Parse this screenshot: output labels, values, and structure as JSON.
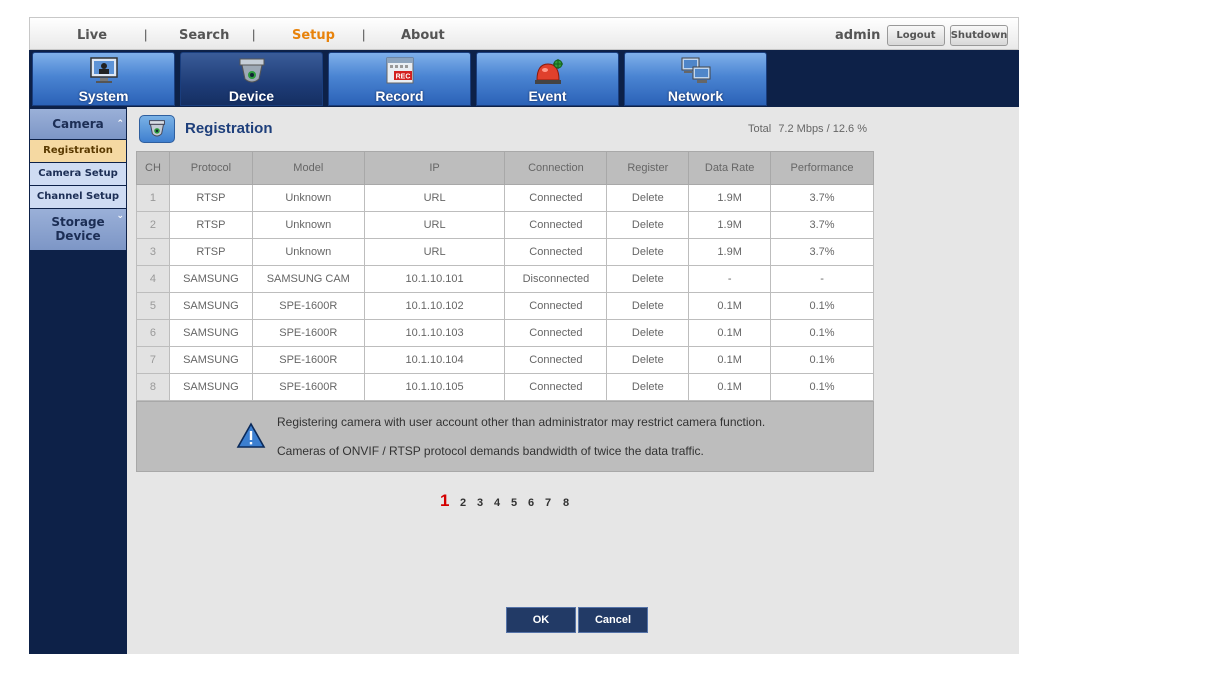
{
  "topnav": {
    "links": [
      "Live",
      "Search",
      "Setup",
      "About"
    ],
    "separator": "|",
    "active": "Setup",
    "user": "admin",
    "logout_label": "Logout",
    "shutdown_label": "Shutdown"
  },
  "menu": {
    "tabs": [
      {
        "label": "System",
        "icon": "monitor-user-icon"
      },
      {
        "label": "Device",
        "icon": "dome-camera-icon"
      },
      {
        "label": "Record",
        "icon": "rec-calendar-icon"
      },
      {
        "label": "Event",
        "icon": "alarm-light-icon"
      },
      {
        "label": "Network",
        "icon": "network-computers-icon"
      }
    ],
    "active": "Device"
  },
  "sidebar": {
    "camera_label": "Camera",
    "items": [
      "Registration",
      "Camera Setup",
      "Channel Setup"
    ],
    "active_item": "Registration",
    "storage_label": "Storage Device"
  },
  "main": {
    "title": "Registration",
    "total_label": "Total",
    "total_value": "7.2 Mbps / 12.6 %",
    "columns": [
      "CH",
      "Protocol",
      "Model",
      "IP",
      "Connection",
      "Register",
      "Data Rate",
      "Performance"
    ],
    "rows": [
      [
        "1",
        "RTSP",
        "Unknown",
        "URL",
        "Connected",
        "Delete",
        "1.9M",
        "3.7%"
      ],
      [
        "2",
        "RTSP",
        "Unknown",
        "URL",
        "Connected",
        "Delete",
        "1.9M",
        "3.7%"
      ],
      [
        "3",
        "RTSP",
        "Unknown",
        "URL",
        "Connected",
        "Delete",
        "1.9M",
        "3.7%"
      ],
      [
        "4",
        "SAMSUNG",
        "SAMSUNG CAM",
        "10.1.10.101",
        "Disconnected",
        "Delete",
        "-",
        "-"
      ],
      [
        "5",
        "SAMSUNG",
        "SPE-1600R",
        "10.1.10.102",
        "Connected",
        "Delete",
        "0.1M",
        "0.1%"
      ],
      [
        "6",
        "SAMSUNG",
        "SPE-1600R",
        "10.1.10.103",
        "Connected",
        "Delete",
        "0.1M",
        "0.1%"
      ],
      [
        "7",
        "SAMSUNG",
        "SPE-1600R",
        "10.1.10.104",
        "Connected",
        "Delete",
        "0.1M",
        "0.1%"
      ],
      [
        "8",
        "SAMSUNG",
        "SPE-1600R",
        "10.1.10.105",
        "Connected",
        "Delete",
        "0.1M",
        "0.1%"
      ]
    ],
    "warning_1": "Registering camera with user account other than administrator may restrict camera function.",
    "warning_2": "Cameras of ONVIF / RTSP protocol demands bandwidth of twice the data traffic.",
    "pages": [
      "1",
      "2",
      "3",
      "4",
      "5",
      "6",
      "7",
      "8"
    ],
    "current_page": "1",
    "ok_label": "OK",
    "cancel_label": "Cancel"
  },
  "colors": {
    "nav_bg": "#0d2148",
    "accent_active": "#e8830c",
    "page_current": "#d40000",
    "title": "#1e3f7b"
  }
}
